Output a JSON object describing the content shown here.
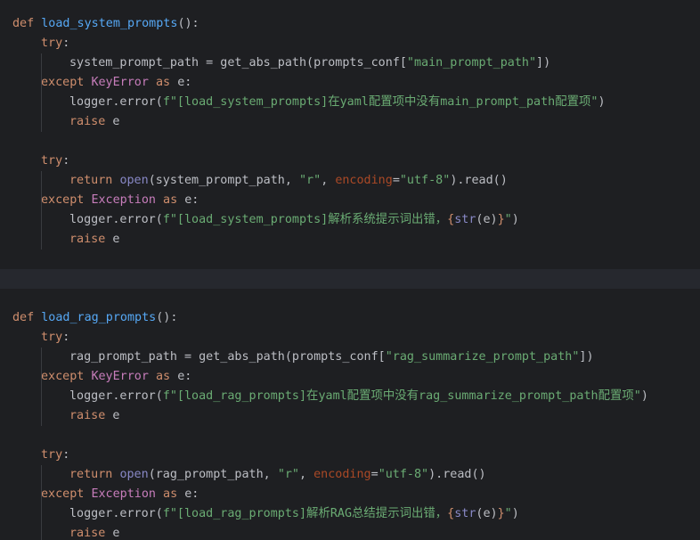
{
  "editor": {
    "lines": [
      [
        {
          "t": "kw",
          "v": "def "
        },
        {
          "t": "fn",
          "v": "load_system_prompts"
        },
        {
          "t": "plain",
          "v": "():"
        }
      ],
      [
        {
          "t": "kw",
          "v": "try"
        },
        {
          "t": "plain",
          "v": ":"
        }
      ],
      [
        {
          "t": "plain",
          "v": "system_prompt_path = get_abs_path(prompts_conf["
        },
        {
          "t": "str",
          "v": "\"main_prompt_path\""
        },
        {
          "t": "plain",
          "v": "])"
        }
      ],
      [
        {
          "t": "kw",
          "v": "except "
        },
        {
          "t": "cls",
          "v": "KeyError"
        },
        {
          "t": "kw",
          "v": " as "
        },
        {
          "t": "plain",
          "v": "e:"
        }
      ],
      [
        {
          "t": "plain",
          "v": "logger.error("
        },
        {
          "t": "str",
          "v": "f\"[load_system_prompts]在yaml配置项中没有main_prompt_path配置项\""
        },
        {
          "t": "plain",
          "v": ")"
        }
      ],
      [
        {
          "t": "kw",
          "v": "raise "
        },
        {
          "t": "plain",
          "v": "e"
        }
      ],
      [],
      [
        {
          "t": "kw",
          "v": "try"
        },
        {
          "t": "plain",
          "v": ":"
        }
      ],
      [
        {
          "t": "kw",
          "v": "return "
        },
        {
          "t": "bi",
          "v": "open"
        },
        {
          "t": "plain",
          "v": "(system_prompt_path, "
        },
        {
          "t": "str",
          "v": "\"r\""
        },
        {
          "t": "plain",
          "v": ", "
        },
        {
          "t": "prm",
          "v": "encoding"
        },
        {
          "t": "plain",
          "v": "="
        },
        {
          "t": "str",
          "v": "\"utf-8\""
        },
        {
          "t": "plain",
          "v": ").read()"
        }
      ],
      [
        {
          "t": "kw",
          "v": "except "
        },
        {
          "t": "cls",
          "v": "Exception"
        },
        {
          "t": "kw",
          "v": " as "
        },
        {
          "t": "plain",
          "v": "e:"
        }
      ],
      [
        {
          "t": "plain",
          "v": "logger.error("
        },
        {
          "t": "str",
          "v": "f\"[load_system_prompts]解析系统提示词出错，"
        },
        {
          "t": "kw",
          "v": "{"
        },
        {
          "t": "bi",
          "v": "str"
        },
        {
          "t": "plain",
          "v": "(e)"
        },
        {
          "t": "kw",
          "v": "}"
        },
        {
          "t": "str",
          "v": "\""
        },
        {
          "t": "plain",
          "v": ")"
        }
      ],
      [
        {
          "t": "kw",
          "v": "raise "
        },
        {
          "t": "plain",
          "v": "e"
        }
      ],
      [],
      [],
      [],
      [
        {
          "t": "kw",
          "v": "def "
        },
        {
          "t": "fn",
          "v": "load_rag_prompts"
        },
        {
          "t": "plain",
          "v": "():"
        }
      ],
      [
        {
          "t": "kw",
          "v": "try"
        },
        {
          "t": "plain",
          "v": ":"
        }
      ],
      [
        {
          "t": "plain",
          "v": "rag_prompt_path = get_abs_path(prompts_conf["
        },
        {
          "t": "str",
          "v": "\"rag_summarize_prompt_path\""
        },
        {
          "t": "plain",
          "v": "])"
        }
      ],
      [
        {
          "t": "kw",
          "v": "except "
        },
        {
          "t": "cls",
          "v": "KeyError"
        },
        {
          "t": "kw",
          "v": " as "
        },
        {
          "t": "plain",
          "v": "e:"
        }
      ],
      [
        {
          "t": "plain",
          "v": "logger.error("
        },
        {
          "t": "str",
          "v": "f\"[load_rag_prompts]在yaml配置项中没有rag_summarize_prompt_path配置项\""
        },
        {
          "t": "plain",
          "v": ")"
        }
      ],
      [
        {
          "t": "kw",
          "v": "raise "
        },
        {
          "t": "plain",
          "v": "e"
        }
      ],
      [],
      [
        {
          "t": "kw",
          "v": "try"
        },
        {
          "t": "plain",
          "v": ":"
        }
      ],
      [
        {
          "t": "kw",
          "v": "return "
        },
        {
          "t": "bi",
          "v": "open"
        },
        {
          "t": "plain",
          "v": "(rag_prompt_path, "
        },
        {
          "t": "str",
          "v": "\"r\""
        },
        {
          "t": "plain",
          "v": ", "
        },
        {
          "t": "prm",
          "v": "encoding"
        },
        {
          "t": "plain",
          "v": "="
        },
        {
          "t": "str",
          "v": "\"utf-8\""
        },
        {
          "t": "plain",
          "v": ").read()"
        }
      ],
      [
        {
          "t": "kw",
          "v": "except "
        },
        {
          "t": "cls",
          "v": "Exception"
        },
        {
          "t": "kw",
          "v": " as "
        },
        {
          "t": "plain",
          "v": "e:"
        }
      ],
      [
        {
          "t": "plain",
          "v": "logger.error("
        },
        {
          "t": "str",
          "v": "f\"[load_rag_prompts]解析RAG总结提示词出错，"
        },
        {
          "t": "kw",
          "v": "{"
        },
        {
          "t": "bi",
          "v": "str"
        },
        {
          "t": "plain",
          "v": "(e)"
        },
        {
          "t": "kw",
          "v": "}"
        },
        {
          "t": "str",
          "v": "\""
        },
        {
          "t": "plain",
          "v": ")"
        }
      ],
      [
        {
          "t": "kw",
          "v": "raise "
        },
        {
          "t": "plain",
          "v": "e"
        }
      ]
    ]
  },
  "colors": {
    "background": "#1e1f22",
    "current_line": "#26282e",
    "keyword": "#cf8e6d",
    "function_name": "#56a8f5",
    "string": "#6aab73",
    "class_name": "#c77dbb",
    "parameter": "#aa4926",
    "builtin": "#8888c6",
    "text": "#bcbec4"
  }
}
